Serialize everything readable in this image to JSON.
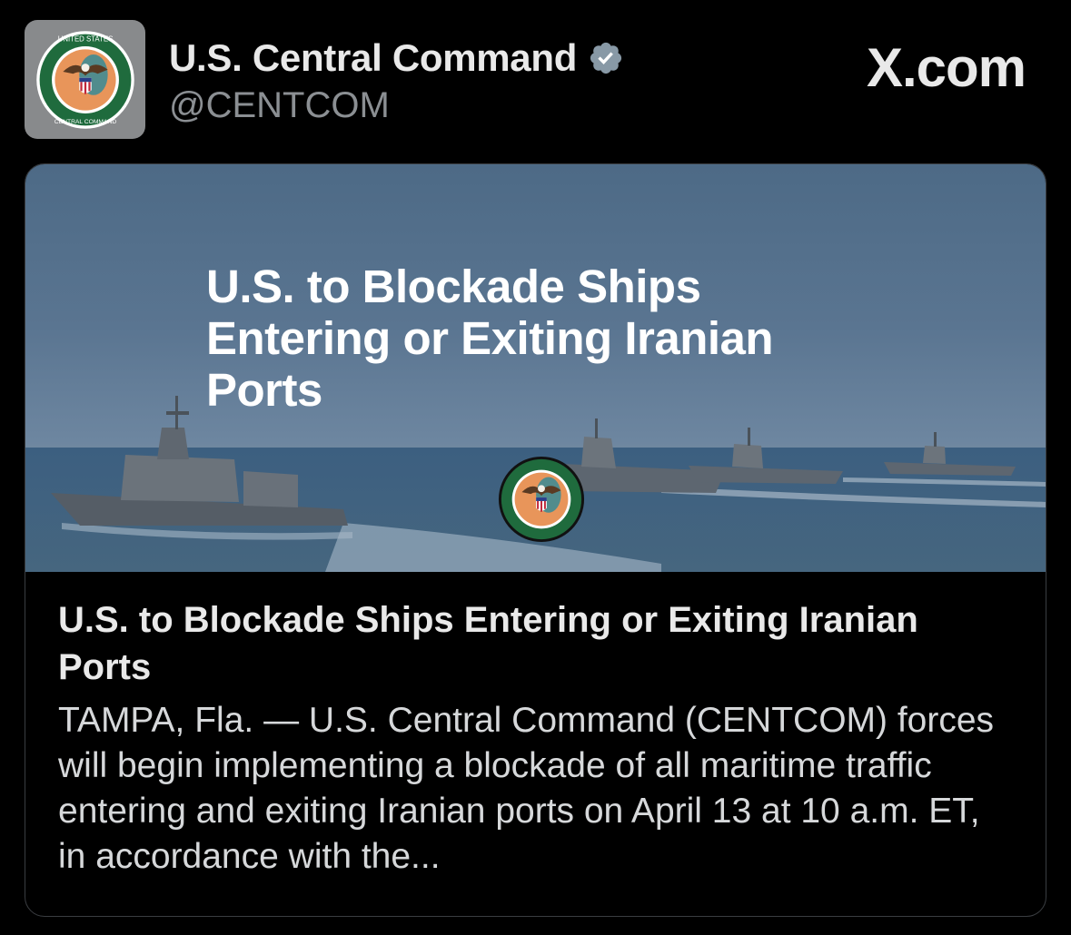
{
  "post": {
    "author": {
      "display_name": "U.S. Central Command",
      "handle": "@CENTCOM",
      "verified_icon": "verified-badge-icon",
      "avatar_icon": "centcom-seal"
    },
    "brand_label": "X.com",
    "card": {
      "image_headline": "U.S. to Blockade Ships Entering or Exiting Iranian Ports",
      "title": "U.S. to Blockade Ships Entering or Exiting Iranian Ports",
      "description": "TAMPA, Fla. — U.S. Central Command (CENTCOM) forces will begin implementing a blockade of all maritime traffic entering and exiting Iranian ports on April 13 at 10 a.m. ET, in accordance with the..."
    }
  },
  "seal_text": {
    "top": "UNITED STATES",
    "bottom": "CENTRAL COMMAND"
  },
  "colors": {
    "background": "#000000",
    "text_primary": "#e9e9e9",
    "text_secondary": "#8b8f93",
    "verified": "#8899a6",
    "seal_ring": "#1f6b3d",
    "seal_center": "#e8955a"
  }
}
